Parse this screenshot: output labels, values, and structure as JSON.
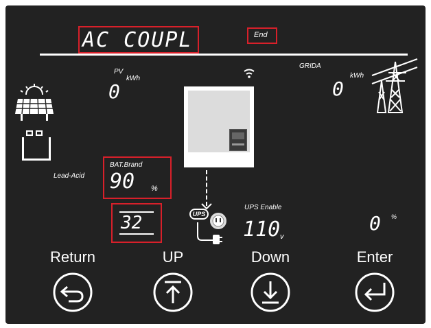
{
  "mode_display": "AC COUPL",
  "end_tag": "End",
  "pv": {
    "label": "PV",
    "unit": "kWh",
    "value": "0"
  },
  "grid": {
    "label": "GRIDA",
    "unit": "kWh",
    "value": "0"
  },
  "battery": {
    "type_label": "Lead-Acid"
  },
  "bat_brand": {
    "label": "BAT.Brand",
    "value": "90",
    "unit": "%"
  },
  "setting_index": "32",
  "ups": {
    "badge": "UPS",
    "label": "UPS Enable",
    "value": "110",
    "unit": "v"
  },
  "load": {
    "value": "0",
    "unit": "%"
  },
  "buttons": {
    "return_label": "Return",
    "up_label": "UP",
    "down_label": "Down",
    "enter_label": "Enter"
  },
  "colors": {
    "highlight": "#d8202a",
    "screen_bg": "#222222",
    "segment": "#ffffff"
  }
}
